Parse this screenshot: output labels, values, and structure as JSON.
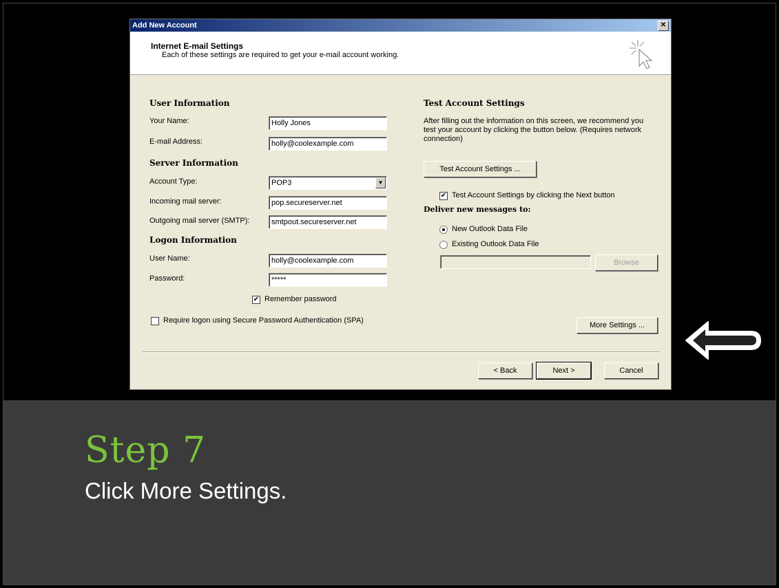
{
  "dialog": {
    "title": "Add New Account",
    "close_glyph": "✕",
    "header_title": "Internet E-mail Settings",
    "header_subtitle": "Each of these settings are required to get your e-mail account working."
  },
  "user_info": {
    "heading": "User Information",
    "name_label": "Your Name:",
    "name_value": "Holly Jones",
    "email_label": "E-mail Address:",
    "email_value": "holly@coolexample.com"
  },
  "server_info": {
    "heading": "Server Information",
    "account_type_label": "Account Type:",
    "account_type_value": "POP3",
    "incoming_label": "Incoming mail server:",
    "incoming_value": "pop.secureserver.net",
    "outgoing_label": "Outgoing mail server (SMTP):",
    "outgoing_value": "smtpout.secureserver.net"
  },
  "logon_info": {
    "heading": "Logon Information",
    "username_label": "User Name:",
    "username_value": "holly@coolexample.com",
    "password_label": "Password:",
    "password_value": "*****",
    "remember_label": "Remember password",
    "spa_label": "Require logon using Secure Password Authentication (SPA)"
  },
  "test_settings": {
    "heading": "Test Account Settings",
    "description": "After filling out the information on this screen, we recommend you test your account by clicking the button below. (Requires network connection)",
    "test_button": "Test Account Settings ...",
    "test_next_label": "Test Account Settings by clicking the Next button",
    "deliver_heading": "Deliver new messages to:",
    "new_file_label": "New Outlook Data File",
    "existing_file_label": "Existing Outlook Data File",
    "browse_button": "Browse",
    "more_settings_button": "More Settings ..."
  },
  "footer": {
    "back_button": "< Back",
    "next_button": "Next >",
    "cancel_button": "Cancel"
  },
  "slide": {
    "step_title": "Step 7",
    "step_description": "Click More Settings."
  },
  "colors": {
    "step_title": "#7cc43e",
    "band": "#3b3b3b",
    "titlebar": "#0a246a"
  }
}
